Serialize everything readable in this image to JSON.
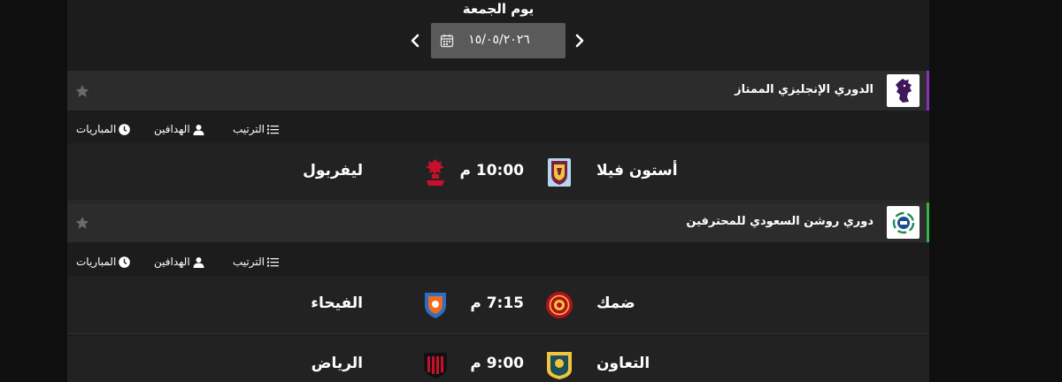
{
  "day_nav": {
    "title": "يوم الجمعة",
    "date": "١٥/٠٥/٢٠٢٦"
  },
  "tabs": {
    "standings": "الترتيب",
    "scorers": "الهدافين",
    "matches": "المباريات"
  },
  "leagues": [
    {
      "name": "الدوري الإنجليزي الممتاز",
      "accent": "#8b2fbf",
      "matches": [
        {
          "home": "أستون فيلا",
          "time": "10:00 م",
          "away": "ليفربول"
        }
      ]
    },
    {
      "name": "دوري روشن السعودي للمحترفين",
      "accent": "#34b34a",
      "matches": [
        {
          "home": "ضمك",
          "time": "7:15 م",
          "away": "الفيحاء"
        },
        {
          "home": "التعاون",
          "time": "9:00 م",
          "away": "الرياض"
        }
      ]
    }
  ],
  "icons": {
    "calendar": "calendar-icon",
    "star": "star-icon",
    "standings": "list-icon",
    "scorers": "user-icon",
    "matches": "clock-icon"
  }
}
